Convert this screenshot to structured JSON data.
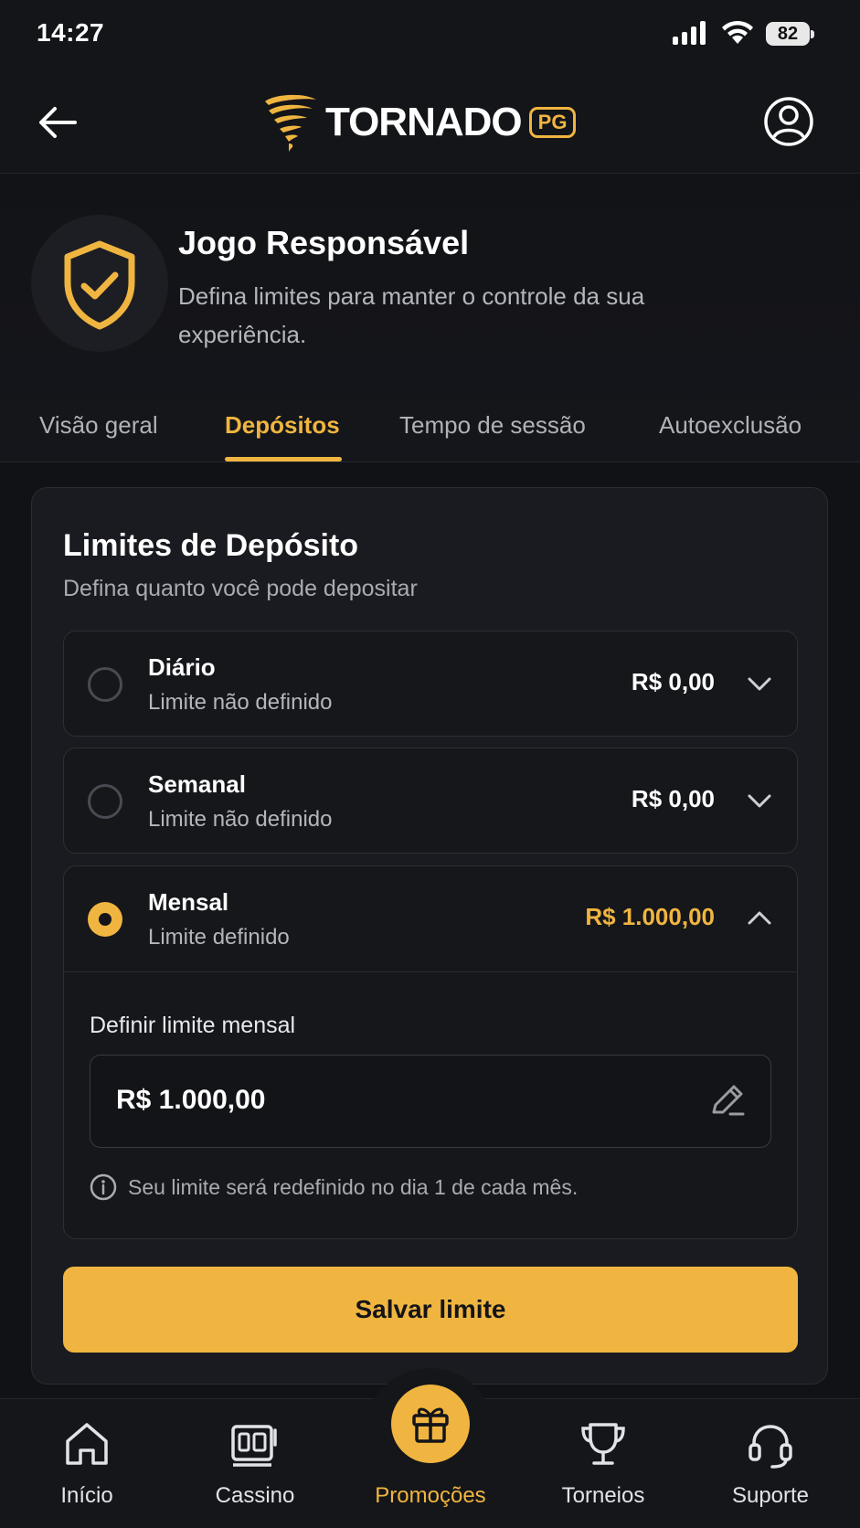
{
  "status_bar": {
    "time": "14:27",
    "battery": "82"
  },
  "header": {
    "logo_text": "TORNADO",
    "logo_badge": "PG"
  },
  "hero": {
    "title": "Jogo Responsável",
    "subtitle": "Defina limites para manter o controle da sua experiência."
  },
  "tabs": [
    {
      "label": "Visão geral"
    },
    {
      "label": "Depósitos",
      "active": true
    },
    {
      "label": "Tempo de sessão"
    },
    {
      "label": "Autoexclusão"
    }
  ],
  "card": {
    "title": "Limites de Depósito",
    "subtitle": "Defina quanto você pode depositar",
    "options": [
      {
        "name": "Diário",
        "status": "Limite não definido",
        "amount": "R$ 0,00",
        "selected": false
      },
      {
        "name": "Semanal",
        "status": "Limite não definido",
        "amount": "R$ 0,00",
        "selected": false
      },
      {
        "name": "Mensal",
        "status": "Limite definido",
        "amount": "R$ 1.000,00",
        "selected": true
      }
    ],
    "input_label": "Definir limite mensal",
    "input_value": "R$ 1.000,00",
    "info_text": "Seu limite será redefinido no dia 1 de cada mês.",
    "save_label": "Salvar limite"
  },
  "bottom_nav": [
    {
      "label": "Início",
      "icon": "home-icon"
    },
    {
      "label": "Cassino",
      "icon": "slot-machine-icon"
    },
    {
      "label": "Promoções",
      "icon": "gift-icon",
      "active": true
    },
    {
      "label": "Torneios",
      "icon": "trophy-icon"
    },
    {
      "label": "Suporte",
      "icon": "headset-icon"
    }
  ],
  "colors": {
    "accent": "#f0b540",
    "background": "#111216",
    "card": "#1a1b20"
  }
}
